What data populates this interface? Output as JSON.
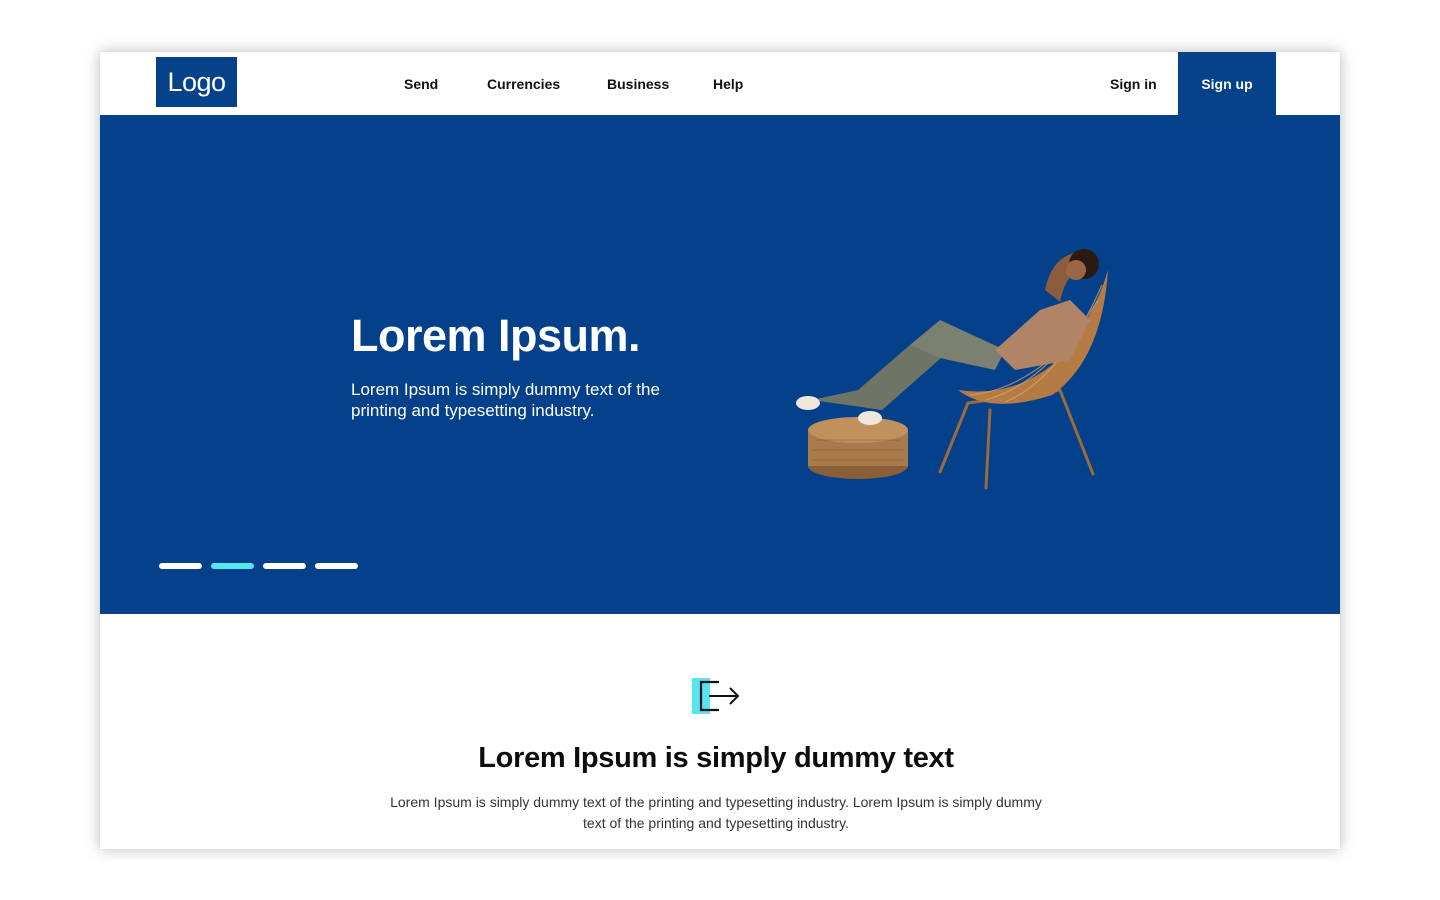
{
  "header": {
    "logo": "Logo",
    "nav": [
      "Send",
      "Currencies",
      "Business",
      "Help"
    ],
    "sign_in": "Sign in",
    "sign_up": "Sign up"
  },
  "hero": {
    "title": "Lorem Ipsum.",
    "subtitle": "Lorem Ipsum is simply dummy text of the printing and typesetting industry.",
    "illustration": "woman-relaxing-in-chair-illustration",
    "carousel": {
      "count": 4,
      "active_index": 1
    }
  },
  "feature": {
    "icon": "exit-arrow-icon",
    "title": "Lorem Ipsum is simply dummy text",
    "body": "Lorem Ipsum is simply dummy text of the printing and typesetting industry. Lorem Ipsum is simply dummy text of the printing and typesetting industry."
  },
  "colors": {
    "brand": "#05428a",
    "accent": "#55e6f2",
    "text": "#111111"
  }
}
